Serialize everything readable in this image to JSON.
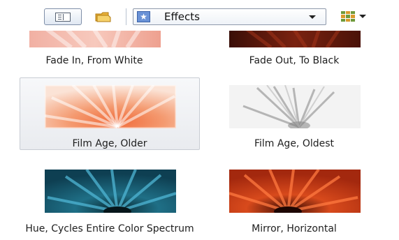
{
  "toolbar": {
    "view_button_icon": "detail-pane-icon",
    "folder_icon": "folder-icon",
    "dropdown": {
      "icon": "star-icon",
      "icon_glyph": "★",
      "selected": "Effects"
    },
    "layout_icon": "thumbnail-grid-icon"
  },
  "effects": [
    {
      "name": "Fade In, From White"
    },
    {
      "name": "Fade Out, To Black"
    },
    {
      "name": "Film Age, Older",
      "selected": true
    },
    {
      "name": "Film Age, Oldest"
    },
    {
      "name": "Hue, Cycles Entire Color Spectrum"
    },
    {
      "name": "Mirror, Horizontal"
    }
  ],
  "colors": {
    "selection_border": "#c8ccd3",
    "dropdown_icon": "#6a92d6"
  }
}
